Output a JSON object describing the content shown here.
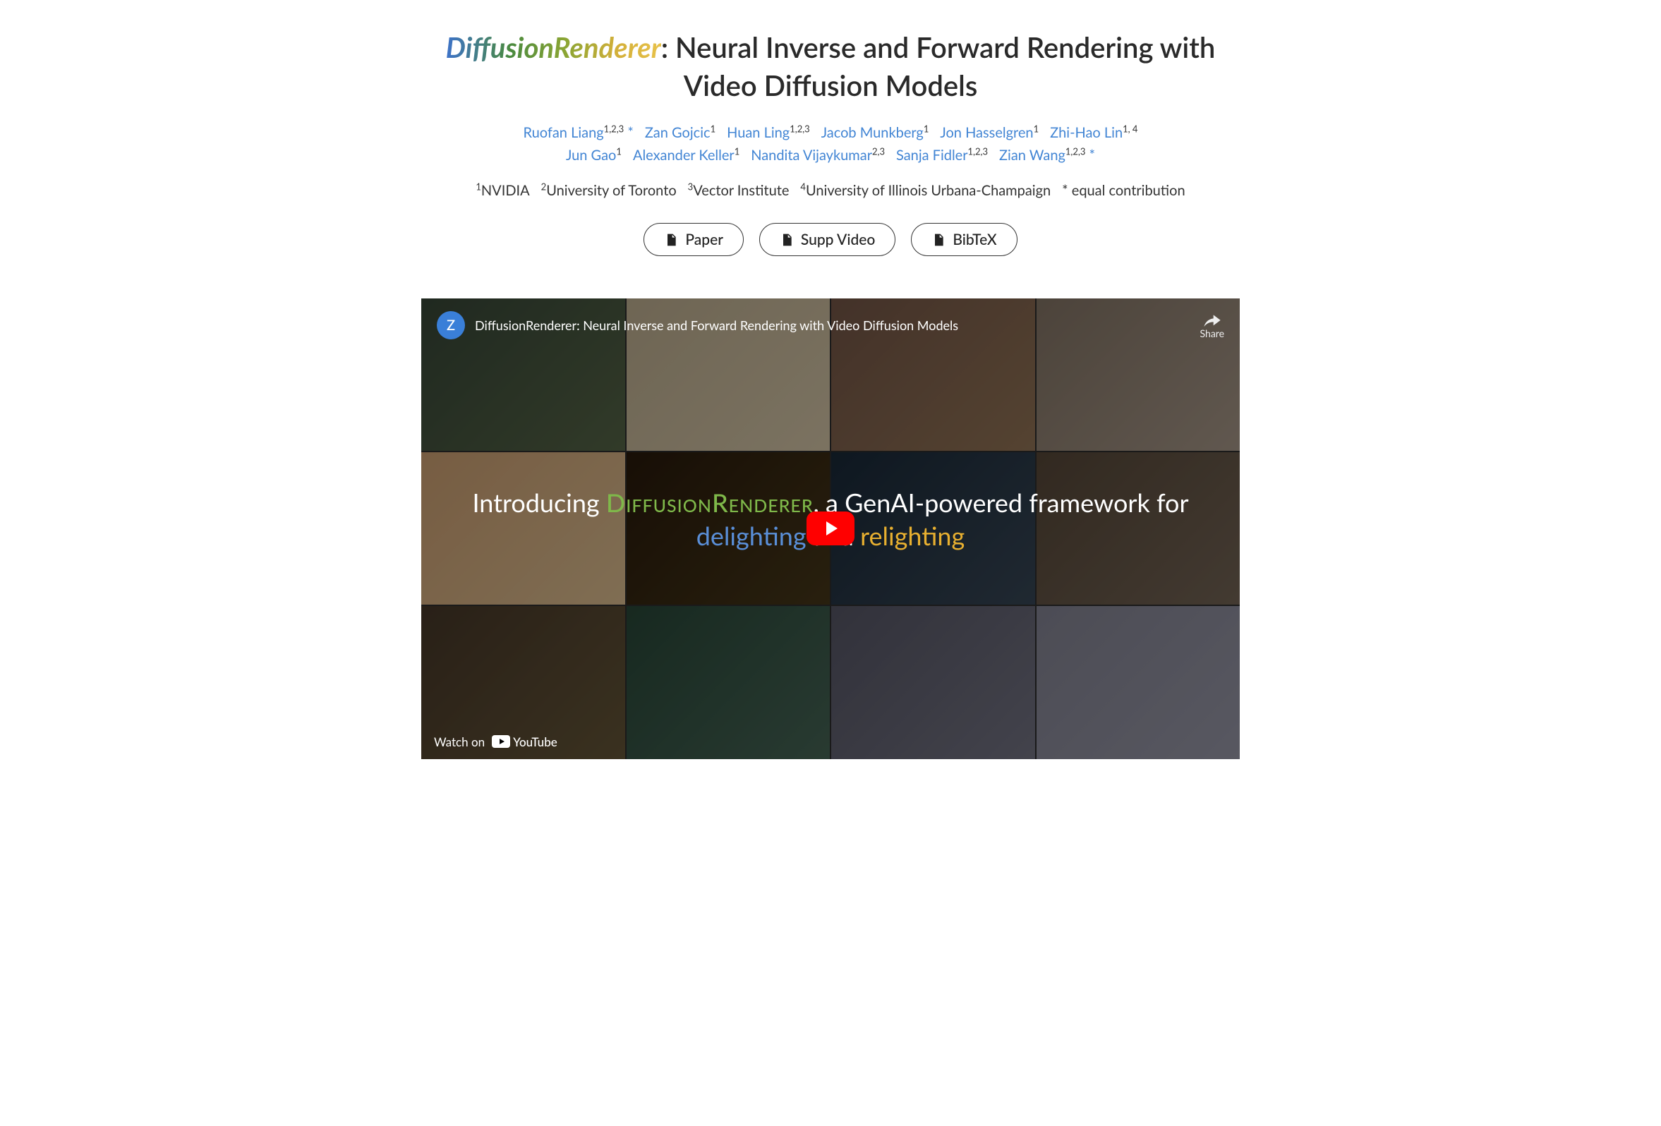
{
  "title": {
    "brand": "DiffusionRenderer",
    "rest": ": Neural Inverse and Forward Rendering with Video Diffusion Models"
  },
  "authors": [
    {
      "name": "Ruofan Liang",
      "aff": "1,2,3",
      "extra": " *"
    },
    {
      "name": "Zan Gojcic",
      "aff": "1",
      "extra": ""
    },
    {
      "name": "Huan Ling",
      "aff": "1,2,3",
      "extra": ""
    },
    {
      "name": "Jacob Munkberg",
      "aff": "1",
      "extra": ""
    },
    {
      "name": "Jon Hasselgren",
      "aff": "1",
      "extra": ""
    },
    {
      "name": "Zhi-Hao Lin",
      "aff": "1, 4",
      "extra": ""
    },
    {
      "name": "Jun Gao",
      "aff": "1",
      "extra": ""
    },
    {
      "name": "Alexander Keller",
      "aff": "1",
      "extra": ""
    },
    {
      "name": "Nandita Vijaykumar",
      "aff": "2,3",
      "extra": ""
    },
    {
      "name": "Sanja Fidler",
      "aff": "1,2,3",
      "extra": ""
    },
    {
      "name": "Zian Wang",
      "aff": "1,2,3",
      "extra": " *"
    }
  ],
  "affiliations": [
    {
      "num": "1",
      "name": "NVIDIA"
    },
    {
      "num": "2",
      "name": "University of Toronto"
    },
    {
      "num": "3",
      "name": "Vector Institute"
    },
    {
      "num": "4",
      "name": "University of Illinois Urbana-Champaign"
    }
  ],
  "equal_contrib": "* equal contribution",
  "buttons": {
    "paper": "Paper",
    "supp": "Supp Video",
    "bibtex": "BibTeX"
  },
  "video": {
    "channel_initial": "Z",
    "title": "DiffusionRenderer: Neural Inverse and Forward Rendering with Video Diffusion Models",
    "share": "Share",
    "overlay": {
      "intro": "Introducing ",
      "brand": "DiffusionRenderer",
      "mid1": ", a GenAI-powered framework for ",
      "de": "delighting",
      "mid2": " and ",
      "re": "relighting"
    },
    "watch_on": "Watch on",
    "youtube": "YouTube"
  }
}
